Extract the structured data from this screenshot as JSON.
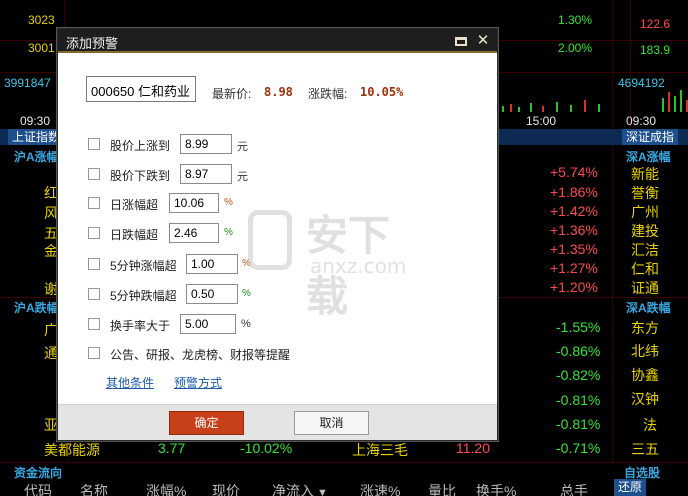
{
  "background": {
    "left_prices": [
      "3023",
      "3001",
      "3991847"
    ],
    "right_prices": [
      "122.6",
      "183.9",
      "4694192"
    ],
    "pct_labels": [
      "1.30%",
      "2.00%"
    ],
    "time_left": "09:30",
    "time_right": "09:30",
    "time_mid": "15:00",
    "tab_left": "上证指数",
    "tab_right": "深证成指",
    "sh_up_title": "沪A涨幅",
    "sz_up_title": "深A涨幅",
    "sh_down_title": "沪A跌幅",
    "sz_down_title": "深A跌幅",
    "left_name_fragments": [
      "红",
      "风",
      "五",
      "金",
      "谢",
      "广",
      "通",
      "亚"
    ],
    "up_pcts": [
      "+5.74%",
      "+1.86%",
      "+1.42%",
      "+1.36%",
      "+1.35%",
      "+1.27%",
      "+1.20%"
    ],
    "down_pcts": [
      "-1.55%",
      "-0.86%",
      "-0.82%",
      "-0.81%",
      "-0.81%",
      "-0.71%"
    ],
    "right_names_up": [
      "新能",
      "誉衡",
      "广州",
      "建投",
      "汇洁",
      "仁和",
      "证通"
    ],
    "right_names_down": [
      "东方",
      "北纬",
      "协鑫",
      "汉钟",
      "法",
      "三五"
    ],
    "last_row": {
      "name": "美都能源",
      "price": "3.77",
      "pct": "-10.02%",
      "name2": "上海三毛",
      "price2": "11.20"
    },
    "bottom_left_title": "资金流向",
    "bottom_right_title": "自选股",
    "columns": [
      "代码",
      "名称",
      "涨幅%",
      "现价",
      "净流入",
      "涨速%",
      "量比",
      "换手%",
      "总手"
    ],
    "restore_label": "还原",
    "colors": {
      "up": "#ff4a4a",
      "down": "#33e633",
      "header": "#36a7e0",
      "tab_bg": "#1d4f8f"
    }
  },
  "watermark": {
    "text": "安下载",
    "sub": "anxz.com"
  },
  "dialog": {
    "title": "添加预警",
    "stock_field": "000650 仁和药业",
    "latest_price_label": "最新价:",
    "latest_price_value": "8.98",
    "change_label": "涨跌幅:",
    "change_value": "10.05%",
    "options": [
      {
        "label": "股价上涨到",
        "value": "8.99",
        "unit": "元"
      },
      {
        "label": "股价下跌到",
        "value": "8.97",
        "unit": "元"
      },
      {
        "label": "日涨幅超",
        "value": "10.06",
        "unit": "%"
      },
      {
        "label": "日跌幅超",
        "value": "2.46",
        "unit": "%"
      },
      {
        "label": "5分钟涨幅超",
        "value": "1.00",
        "unit": "%"
      },
      {
        "label": "5分钟跌幅超",
        "value": "0.50",
        "unit": "%"
      },
      {
        "label": "换手率大于",
        "value": "5.00",
        "unit": "%"
      },
      {
        "label": "公告、研报、龙虎榜、财报等提醒"
      }
    ],
    "link_other": "其他条件",
    "link_method": "预警方式",
    "ok_label": "确定",
    "cancel_label": "取消",
    "accent_color": "#c8401a"
  }
}
